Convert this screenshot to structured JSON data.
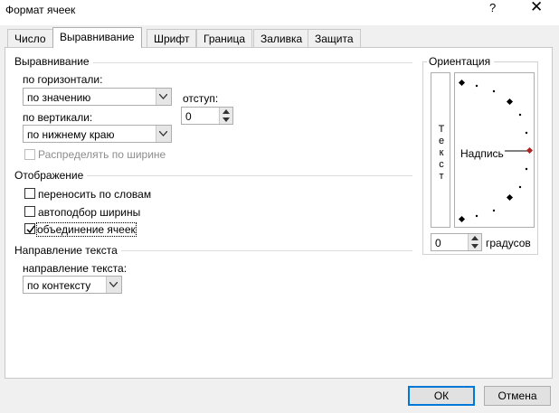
{
  "window": {
    "title": "Формат ячеек",
    "help_label": "?",
    "close_label": "✕"
  },
  "tabs": [
    {
      "label": "Число",
      "active": false
    },
    {
      "label": "Выравнивание",
      "active": true
    },
    {
      "label": "Шрифт",
      "active": false
    },
    {
      "label": "Граница",
      "active": false
    },
    {
      "label": "Заливка",
      "active": false
    },
    {
      "label": "Защита",
      "active": false
    }
  ],
  "alignment": {
    "section_title": "Выравнивание",
    "horizontal_label": "по горизонтали:",
    "horizontal_value": "по значению",
    "indent_label": "отступ:",
    "indent_value": "0",
    "vertical_label": "по вертикали:",
    "vertical_value": "по нижнему краю",
    "distribute_label": "Распределять по ширине"
  },
  "display": {
    "section_title": "Отображение",
    "wrap_label": "переносить по словам",
    "wrap_checked": false,
    "autofit_label": "автоподбор ширины",
    "autofit_checked": false,
    "merge_label": "объединение ячеек",
    "merge_checked": true
  },
  "direction": {
    "section_title": "Направление текста",
    "label": "направление текста:",
    "value": "по контексту"
  },
  "orientation": {
    "section_title": "Ориентация",
    "vertical_text": [
      "Т",
      "е",
      "к",
      "с",
      "т"
    ],
    "dial_label": "Надпись",
    "degrees_value": "0",
    "degrees_label": "градусов",
    "accent_color": "#b22222"
  },
  "buttons": {
    "ok": "ОК",
    "cancel": "Отмена"
  },
  "colors": {
    "default_button_border": "#0078d7",
    "panel_bg": "#ffffff",
    "dialog_bg": "#f0f0f0"
  }
}
